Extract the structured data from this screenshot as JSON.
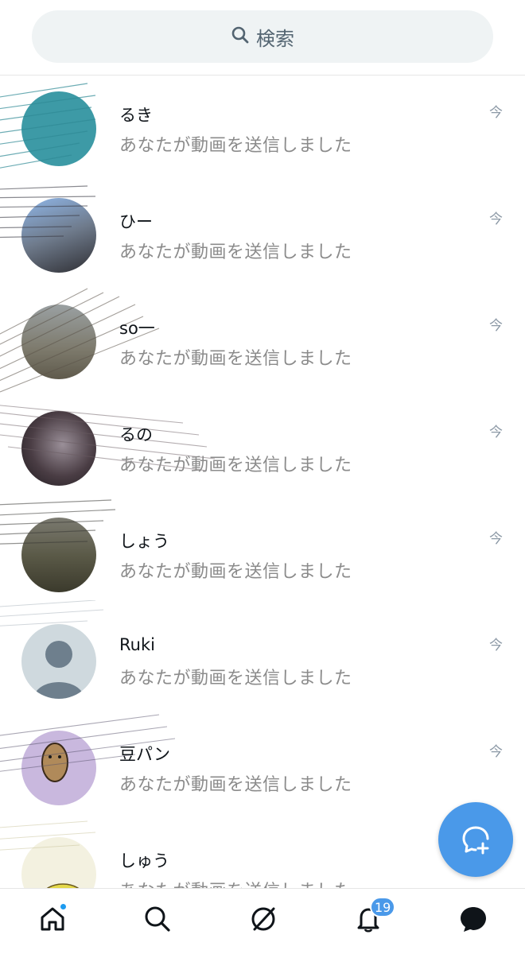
{
  "search": {
    "label": "検索"
  },
  "conversations": [
    {
      "name": "るき",
      "preview": "あなたが動画を送信しました",
      "time": "今",
      "avatar_color": "#3d9aa6"
    },
    {
      "name": "ひー",
      "preview": "あなたが動画を送信しました",
      "time": "今",
      "avatar_color": "#6f7b8c"
    },
    {
      "name": "so一",
      "preview": "あなたが動画を送信しました",
      "time": "今",
      "avatar_color": "#8a8a82"
    },
    {
      "name": "るの",
      "preview": "あなたが動画を送信しました",
      "time": "今",
      "avatar_color": "#4a3d44"
    },
    {
      "name": "しょう",
      "preview": "あなたが動画を送信しました",
      "time": "今",
      "avatar_color": "#5b5a48"
    },
    {
      "name": "Ruki",
      "preview": "あなたが動画を送信しました",
      "time": "今",
      "avatar_color": "#cfd9de"
    },
    {
      "name": "豆パン",
      "preview": "あなたが動画を送信しました",
      "time": "今",
      "avatar_color": "#c9b8de"
    },
    {
      "name": "しゅう",
      "preview": "あなたが動画を送信しました",
      "time": "",
      "avatar_color": "#e9e4a8"
    }
  ],
  "bottom_nav": {
    "notifications_badge": "19",
    "items": [
      "home-icon",
      "search-icon",
      "spaces-icon",
      "bell-icon",
      "messages-icon"
    ]
  },
  "colors": {
    "accent": "#4a99e9",
    "preview_text": "#8b8b8b",
    "search_bg": "#eff3f4"
  }
}
